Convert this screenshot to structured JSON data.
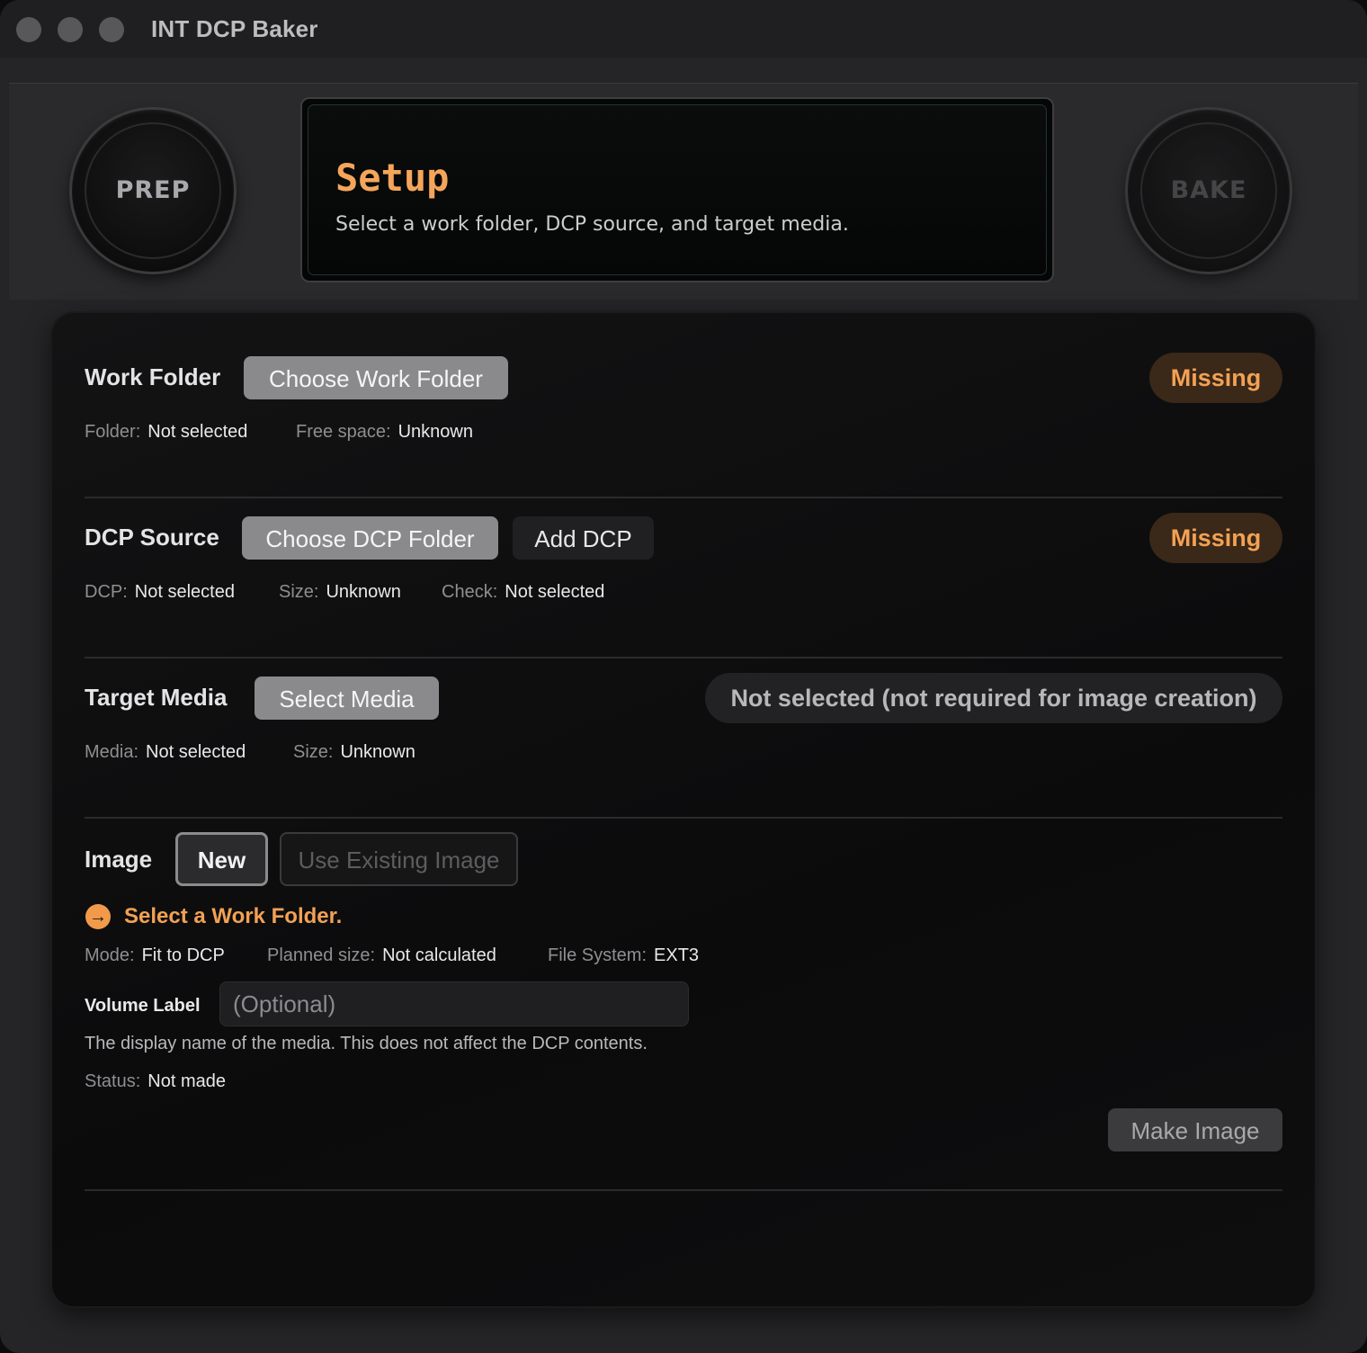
{
  "window": {
    "title": "INT DCP Baker"
  },
  "top": {
    "prep_label": "PREP",
    "bake_label": "BAKE",
    "status_title": "Setup",
    "status_subtitle": "Select a work folder, DCP source, and target media."
  },
  "work_folder": {
    "title": "Work Folder",
    "choose_button": "Choose Work Folder",
    "badge": "Missing",
    "meta": [
      {
        "key": "Folder:",
        "value": "Not selected"
      },
      {
        "key": "Free space:",
        "value": "Unknown"
      }
    ]
  },
  "dcp_source": {
    "title": "DCP Source",
    "choose_button": "Choose DCP Folder",
    "add_button": "Add DCP",
    "badge": "Missing",
    "meta": [
      {
        "key": "DCP:",
        "value": "Not selected"
      },
      {
        "key": "Size:",
        "value": "Unknown"
      },
      {
        "key": "Check:",
        "value": "Not selected"
      }
    ]
  },
  "target_media": {
    "title": "Target Media",
    "select_button": "Select Media",
    "badge": "Not selected (not required for image creation)",
    "meta": [
      {
        "key": "Media:",
        "value": "Not selected"
      },
      {
        "key": "Size:",
        "value": "Unknown"
      }
    ]
  },
  "image": {
    "title": "Image",
    "new_button": "New",
    "use_existing_button": "Use Existing Image",
    "warning": "Select a Work Folder.",
    "meta": [
      {
        "key": "Mode:",
        "value": "Fit to DCP"
      },
      {
        "key": "Planned size:",
        "value": "Not calculated"
      },
      {
        "key": "File System:",
        "value": "EXT3"
      }
    ],
    "volume_label": "Volume Label",
    "volume_placeholder": "(Optional)",
    "volume_value": "",
    "help": "The display name of the media. This does not affect the DCP contents.",
    "status_key": "Status:",
    "status_value": "Not made",
    "make_button": "Make Image"
  },
  "colors": {
    "accent_orange": "#f3a154",
    "missing_bg": "#3a2818",
    "window_bg": "#252527",
    "panel_bg": "#0e0e0f"
  },
  "icons": {
    "warning": "arrow-right-circle-icon"
  }
}
